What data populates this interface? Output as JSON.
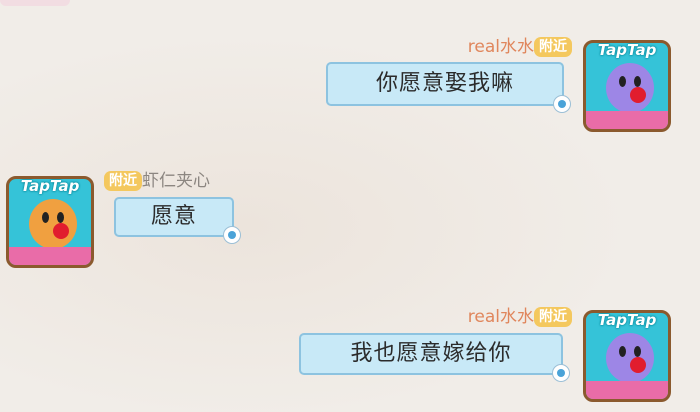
{
  "messages": [
    {
      "side": "right",
      "name": "real水水",
      "badge": "附近",
      "text": "你愿意娶我嘛",
      "avatar": "purple-mole-avatar"
    },
    {
      "side": "left",
      "name": "虾仁夹心",
      "badge": "附近",
      "text": "愿意",
      "avatar": "orange-mole-avatar"
    },
    {
      "side": "right",
      "name": "real水水",
      "badge": "附近",
      "text": "我也愿意嫁给你",
      "avatar": "purple-mole-avatar"
    }
  ],
  "avatar_logo": "TapTap",
  "colors": {
    "bubble": "#c8e9f7",
    "bubble_border": "#8dc3e0",
    "badge": "#f4c85e",
    "self_name": "#e0865c",
    "other_name": "#8c8681",
    "purple_mole": "#9d86e6",
    "orange_mole": "#f0a040"
  }
}
